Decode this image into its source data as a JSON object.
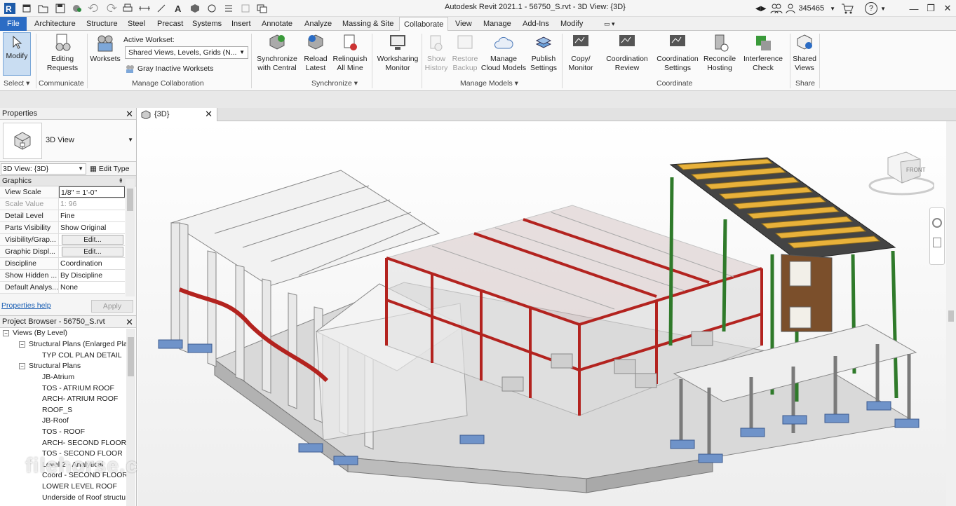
{
  "title": "Autodesk Revit 2021.1 - 56750_S.rvt - 3D View: {3D}",
  "user_id": "345465",
  "tabs": [
    "File",
    "Architecture",
    "Structure",
    "Steel",
    "Precast",
    "Systems",
    "Insert",
    "Annotate",
    "Analyze",
    "Massing & Site",
    "Collaborate",
    "View",
    "Manage",
    "Add-Ins",
    "Modify"
  ],
  "ribbon": {
    "modify": "Modify",
    "select_label": "Select",
    "editing_requests_1": "Editing",
    "editing_requests_2": "Requests",
    "communicate_label": "Communicate",
    "worksets": "Worksets",
    "active_workset_label": "Active Workset:",
    "active_workset_value": "Shared Views, Levels, Grids (N...",
    "gray_inactive": "Gray Inactive Worksets",
    "manage_collab_label": "Manage Collaboration",
    "sync_1": "Synchronize",
    "sync_2": "with Central",
    "reload_1": "Reload",
    "reload_2": "Latest",
    "relinquish_1": "Relinquish",
    "relinquish_2": "All Mine",
    "synchronize_label": "Synchronize",
    "ws_monitor_1": "Worksharing",
    "ws_monitor_2": "Monitor",
    "show_history_1": "Show",
    "show_history_2": "History",
    "restore_backup_1": "Restore",
    "restore_backup_2": "Backup",
    "manage_cloud_1": "Manage",
    "manage_cloud_2": "Cloud Models",
    "publish_1": "Publish",
    "publish_2": "Settings",
    "manage_models_label": "Manage Models",
    "copy_monitor_1": "Copy/",
    "copy_monitor_2": "Monitor",
    "coord_review_1": "Coordination",
    "coord_review_2": "Review",
    "coord_settings_1": "Coordination",
    "coord_settings_2": "Settings",
    "reconcile_1": "Reconcile",
    "reconcile_2": "Hosting",
    "interference_1": "Interference",
    "interference_2": "Check",
    "coordinate_label": "Coordinate",
    "shared_views_1": "Shared",
    "shared_views_2": "Views",
    "share_label": "Share"
  },
  "properties": {
    "title": "Properties",
    "type_name": "3D View",
    "view_selector": "3D View: {3D}",
    "edit_type": "Edit Type",
    "group": "Graphics",
    "rows": [
      {
        "k": "View Scale",
        "v": "1/8\" = 1'-0\""
      },
      {
        "k": "Scale Value",
        "v1": "1:",
        "v": "96"
      },
      {
        "k": "Detail Level",
        "v": "Fine"
      },
      {
        "k": "Parts Visibility",
        "v": "Show Original"
      },
      {
        "k": "Visibility/Grap...",
        "v": "Edit..."
      },
      {
        "k": "Graphic Displ...",
        "v": "Edit..."
      },
      {
        "k": "Discipline",
        "v": "Coordination"
      },
      {
        "k": "Show Hidden ...",
        "v": "By Discipline"
      },
      {
        "k": "Default Analys...",
        "v": "None"
      }
    ],
    "help": "Properties help",
    "apply": "Apply"
  },
  "browser": {
    "title": "Project Browser - 56750_S.rvt",
    "root": "Views (By Level)",
    "group1": "Structural Plans (Enlarged Pla",
    "group1_items": [
      "TYP COL PLAN DETAIL"
    ],
    "group2": "Structural Plans",
    "group2_items": [
      "JB-Atrium",
      "TOS - ATRIUM ROOF",
      "ARCH- ATRIUM ROOF",
      "ROOF_S",
      "JB-Roof",
      "TOS - ROOF",
      "ARCH- SECOND FLOOR",
      "TOS - SECOND FLOOR",
      "Level 2 - Analytical",
      "Coord - SECOND FLOOR",
      "LOWER LEVEL ROOF",
      "Underside of Roof structu"
    ]
  },
  "view_tab": "{3D}",
  "viewcube_label": "FRONT",
  "watermark": "filehorse.com",
  "colors": {
    "accent": "#2b6cc4",
    "steel_red": "#b3231f",
    "column_green": "#2f7a2a",
    "joist_orange": "#e8b13a",
    "footing_blue": "#6f93c9"
  }
}
